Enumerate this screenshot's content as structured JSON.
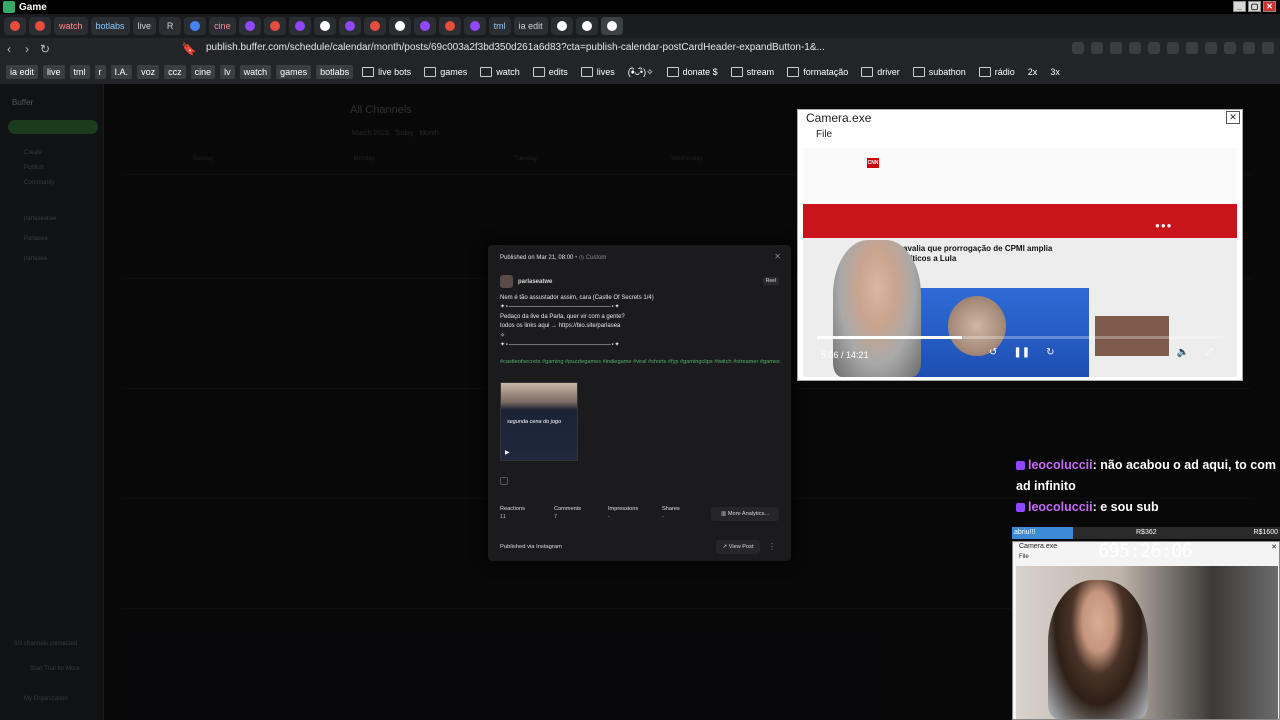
{
  "window": {
    "title": "Game"
  },
  "tabs": [
    {
      "label": "",
      "type": "icon",
      "color": "#e84c3d"
    },
    {
      "label": "",
      "type": "icon",
      "color": "#e84c3d"
    },
    {
      "label": "watch",
      "type": "text",
      "style": "red"
    },
    {
      "label": "botlabs",
      "type": "text",
      "style": "blue"
    },
    {
      "label": "live",
      "type": "text",
      "style": "plain"
    },
    {
      "label": "R",
      "type": "text",
      "style": "plain"
    },
    {
      "label": "",
      "type": "icon",
      "color": "#4285f4"
    },
    {
      "label": "cine",
      "type": "text",
      "style": "red"
    },
    {
      "label": "",
      "type": "icon",
      "color": "#9146ff"
    },
    {
      "label": "",
      "type": "icon",
      "color": "#e84c3d"
    },
    {
      "label": "",
      "type": "icon",
      "color": "#9146ff"
    },
    {
      "label": "",
      "type": "icon",
      "color": "#ffffff"
    },
    {
      "label": "",
      "type": "icon",
      "color": "#9146ff"
    },
    {
      "label": "",
      "type": "icon",
      "color": "#e84c3d"
    },
    {
      "label": "",
      "type": "icon",
      "color": "#ffffff"
    },
    {
      "label": "",
      "type": "icon",
      "color": "#9146ff"
    },
    {
      "label": "",
      "type": "icon",
      "color": "#e84c3d"
    },
    {
      "label": "",
      "type": "icon",
      "color": "#9146ff"
    },
    {
      "label": "tml",
      "type": "text",
      "style": "blue"
    },
    {
      "label": "ia edit",
      "type": "text",
      "style": "plain"
    },
    {
      "label": "",
      "type": "icon",
      "color": "#ffffff"
    },
    {
      "label": "",
      "type": "icon",
      "color": "#ffffff"
    },
    {
      "label": "",
      "type": "active",
      "color": "#ffffff"
    }
  ],
  "address": {
    "url": "publish.buffer.com/schedule/calendar/month/posts/69c003a2f3bd350d261a6d83?cta=publish-calendar-postCardHeader-expandButton-1&..."
  },
  "bookmarks": [
    {
      "label": "ia edit",
      "kind": "pill"
    },
    {
      "label": "live",
      "kind": "pill"
    },
    {
      "label": "tml",
      "kind": "pill"
    },
    {
      "label": "r",
      "kind": "pill"
    },
    {
      "label": "I.A.",
      "kind": "pill"
    },
    {
      "label": "voz",
      "kind": "pill"
    },
    {
      "label": "ccz",
      "kind": "pill"
    },
    {
      "label": "cine",
      "kind": "pill"
    },
    {
      "label": "lv",
      "kind": "pill"
    },
    {
      "label": "watch",
      "kind": "pill"
    },
    {
      "label": "games",
      "kind": "pill"
    },
    {
      "label": "botlabs",
      "kind": "pill"
    },
    {
      "label": "live bots",
      "kind": "folder"
    },
    {
      "label": "games",
      "kind": "folder"
    },
    {
      "label": "watch",
      "kind": "folder"
    },
    {
      "label": "edits",
      "kind": "folder"
    },
    {
      "label": "lives",
      "kind": "folder"
    },
    {
      "label": "(•ิᴗ•ิ)✧",
      "kind": "plain"
    },
    {
      "label": "donate $",
      "kind": "folder"
    },
    {
      "label": "stream",
      "kind": "folder"
    },
    {
      "label": "formatação",
      "kind": "folder"
    },
    {
      "label": "driver",
      "kind": "folder"
    },
    {
      "label": "subathon",
      "kind": "folder"
    },
    {
      "label": "rádio",
      "kind": "folder"
    },
    {
      "label": "2x",
      "kind": "plain"
    },
    {
      "label": "3x",
      "kind": "plain"
    }
  ],
  "buffer": {
    "logo": "Buffer",
    "calendar_title": "All Channels",
    "month": "March 2026",
    "today": "Today",
    "view": "Month",
    "weekdays": [
      "Sunday",
      "Monday",
      "Tuesday",
      "Wednesday",
      "Thursday",
      "Friday",
      "Saturday"
    ],
    "sidebar": [
      {
        "label": "Create"
      },
      {
        "label": "Publish"
      },
      {
        "label": "Community"
      },
      {
        "label": "parlaseatwe"
      },
      {
        "label": "Parlasea"
      },
      {
        "label": "parlasea"
      }
    ],
    "footer": "3/3 channels connected",
    "trial": "Start Trial for More",
    "org": "My Organization"
  },
  "post": {
    "published_on": "Published on Mar 21, 08:00",
    "custom": "Custom",
    "account": "parlaseatwe",
    "type_badge": "Reel",
    "caption": "Nem é tão assustador assim, cara (Castle Of Secrets 1/4)\n✦⋆—————————————————⋆✦\nPedaço da live da Parla, quer vir com a gente?\ntodos os links aqui → https://bio.site/parlasea\n✧\n✦⋆—————————————————⋆✦",
    "hashtags": "#castleofsecrets #gaming #puzzlegames #indiegame #viral #shorts #fyp #gamingclips #twitch #streamer #games",
    "thumb_text": "segunda cena do jogo",
    "stats": [
      {
        "label": "Reactions",
        "value": "11"
      },
      {
        "label": "Comments",
        "value": "7"
      },
      {
        "label": "Impressions",
        "value": "-"
      },
      {
        "label": "Shares",
        "value": "-"
      }
    ],
    "more_analytics": "More Analytics...",
    "published_via": "Published via Instagram",
    "view_post": "View Post"
  },
  "camera_window": {
    "title": "Camera.exe",
    "menu": "File",
    "headline": "avalia que prorrogação de CPMI amplia\nolíticos a Lula",
    "current_time": "5:06",
    "duration": "14:21",
    "progress": 0.356
  },
  "chat": [
    {
      "user": "leocoluccii",
      "message": ": não acabou o ad aqui, to com ad infinito"
    },
    {
      "user": "leocoluccii",
      "message": ": e sou sub"
    }
  ],
  "goal": {
    "label": "abriu!!!",
    "mid": "R$362",
    "end": "R$1600",
    "progress": 0.226
  },
  "subathon_timer": "695:26:06",
  "camera_window_2": {
    "title": "Camera.exe",
    "menu": "File"
  }
}
